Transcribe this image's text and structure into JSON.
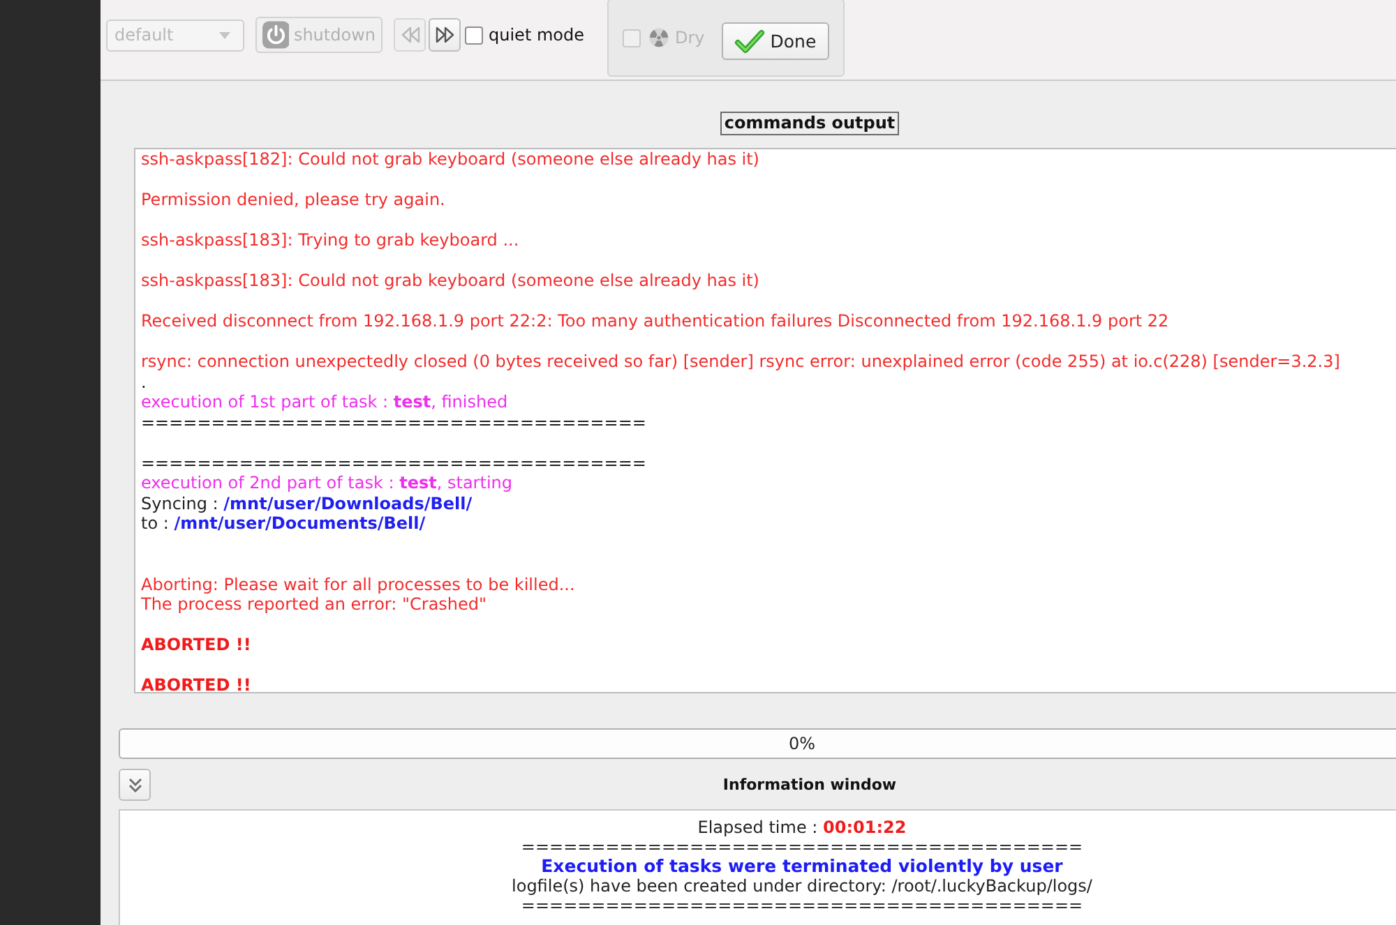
{
  "toolbar": {
    "profile_combo": {
      "value": "default",
      "disabled": true
    },
    "shutdown_button": {
      "label": "shutdown",
      "disabled": true
    },
    "previous_button": {
      "disabled": true
    },
    "next_button": {
      "disabled": false
    },
    "quiet_mode": {
      "label": "quiet mode",
      "checked": false
    }
  },
  "dry_panel": {
    "dry": {
      "label": "Dry",
      "checked": false,
      "disabled": true
    },
    "done_button": {
      "label": "Done"
    }
  },
  "commands_output": {
    "title": "commands output",
    "lines": [
      {
        "kind": "error",
        "text": "ssh-askpass[182]: Could not grab keyboard (someone else already has it)"
      },
      {
        "kind": "blank"
      },
      {
        "kind": "error",
        "text": "Permission denied, please try again."
      },
      {
        "kind": "blank"
      },
      {
        "kind": "error",
        "text": "ssh-askpass[183]: Trying to grab keyboard ..."
      },
      {
        "kind": "blank"
      },
      {
        "kind": "error",
        "text": "ssh-askpass[183]: Could not grab keyboard (someone else already has it)"
      },
      {
        "kind": "blank"
      },
      {
        "kind": "error",
        "text": "Received disconnect from 192.168.1.9 port 22:2: Too many authentication failures Disconnected from 192.168.1.9 port 22"
      },
      {
        "kind": "blank"
      },
      {
        "kind": "error",
        "text": "rsync: connection unexpectedly closed (0 bytes received so far) [sender] rsync error: unexplained error (code 255) at io.c(228) [sender=3.2.3]"
      },
      {
        "kind": "plain",
        "text": "."
      },
      {
        "kind": "progress",
        "text": "execution of 1st part of task : **test**, finished"
      },
      {
        "kind": "separator",
        "text": "===================================="
      },
      {
        "kind": "blank"
      },
      {
        "kind": "separator",
        "text": "===================================="
      },
      {
        "kind": "progress",
        "text": "execution of 2nd part of task : **test**, starting"
      },
      {
        "kind": "path",
        "label": "Syncing :",
        "path": "/mnt/user/Downloads/Bell/"
      },
      {
        "kind": "path",
        "label": "to :",
        "path": "/mnt/user/Documents/Bell/"
      },
      {
        "kind": "blank"
      },
      {
        "kind": "blank"
      },
      {
        "kind": "error",
        "text": "Aborting: Please wait for all processes to be killed..."
      },
      {
        "kind": "error",
        "text": "The process reported an error: \"Crashed\""
      },
      {
        "kind": "blank"
      },
      {
        "kind": "aborted",
        "text": "ABORTED !!"
      },
      {
        "kind": "blank"
      },
      {
        "kind": "aborted",
        "text": "ABORTED !!"
      }
    ]
  },
  "progress": {
    "level": 0,
    "label": "0%"
  },
  "information_window": {
    "title": "Information window",
    "elapsed_label": "Elapsed time :",
    "elapsed_value": "00:01:22",
    "lines": [
      {
        "kind": "separator",
        "text": "========================================"
      },
      {
        "kind": "notice",
        "text": "Execution of tasks were terminated violently by user"
      },
      {
        "kind": "plain",
        "text": "logfile(s) have been created under directory: /root/.luckyBackup/logs/"
      },
      {
        "kind": "separator",
        "text": "========================================"
      }
    ]
  }
}
